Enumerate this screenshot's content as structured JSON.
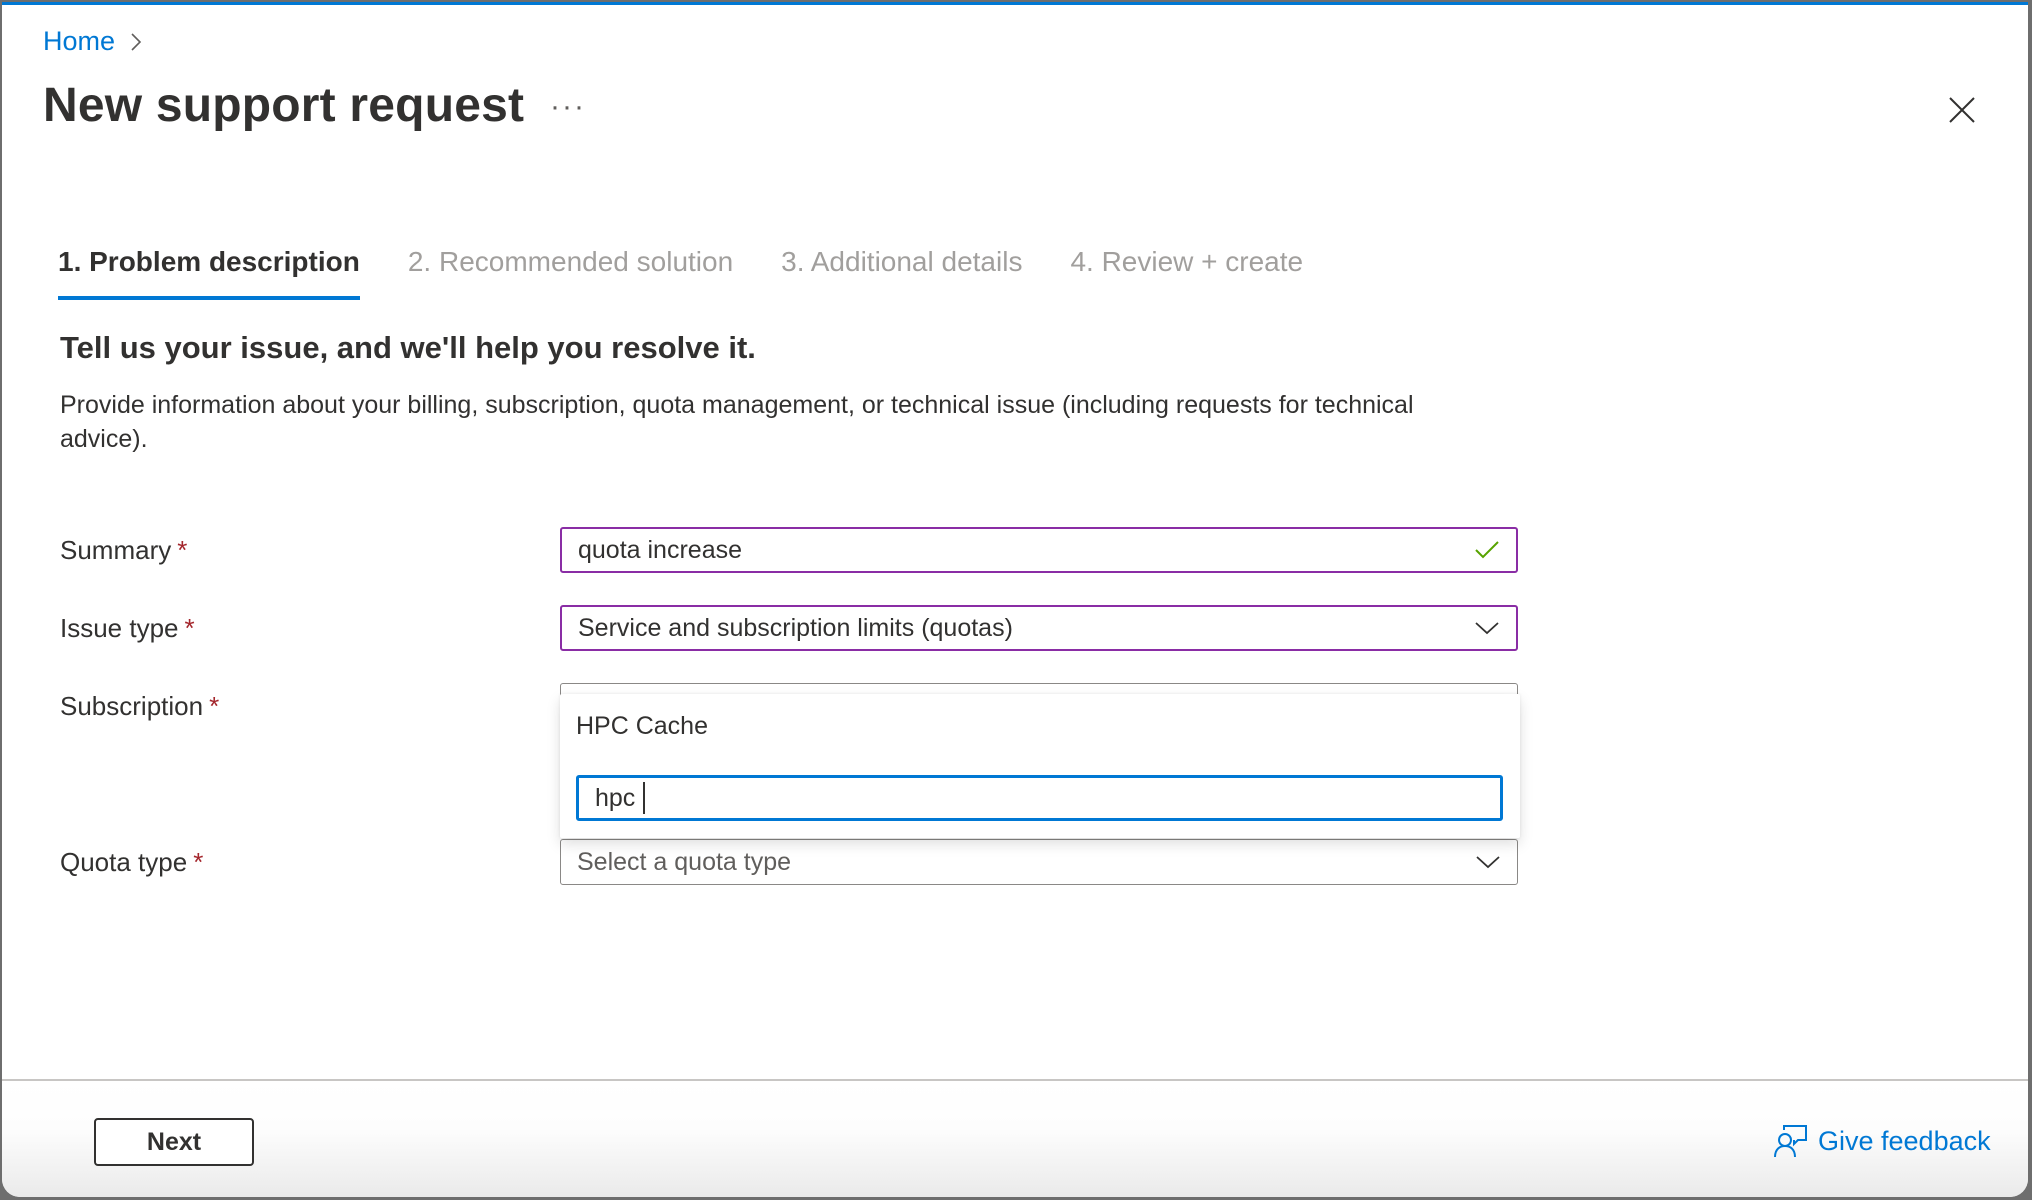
{
  "breadcrumb": {
    "home": "Home"
  },
  "header": {
    "title": "New support request",
    "more_label": "···"
  },
  "tabs": [
    {
      "label": "1. Problem description",
      "active": true
    },
    {
      "label": "2. Recommended solution",
      "active": false
    },
    {
      "label": "3. Additional details",
      "active": false
    },
    {
      "label": "4. Review + create",
      "active": false
    }
  ],
  "intro": {
    "heading": "Tell us your issue, and we'll help you resolve it.",
    "description": "Provide information about your billing, subscription, quota management, or technical issue (including requests for technical advice)."
  },
  "form": {
    "required_marker": "*",
    "summary": {
      "label": "Summary",
      "value": "quota increase",
      "valid_icon": "checkmark-icon"
    },
    "issue_type": {
      "label": "Issue type",
      "value": "Service and subscription limits (quotas)"
    },
    "subscription": {
      "label": "Subscription",
      "dropdown_open": true,
      "options": [
        "HPC Cache"
      ],
      "search_value": "hpc"
    },
    "quota_type": {
      "label": "Quota type",
      "placeholder": "Select a quota type"
    }
  },
  "footer": {
    "next_label": "Next",
    "feedback_label": "Give feedback"
  },
  "colors": {
    "accent": "#0078d4",
    "validated_border": "#8a2da5",
    "valid_check": "#57a300",
    "required": "#a4262c"
  }
}
